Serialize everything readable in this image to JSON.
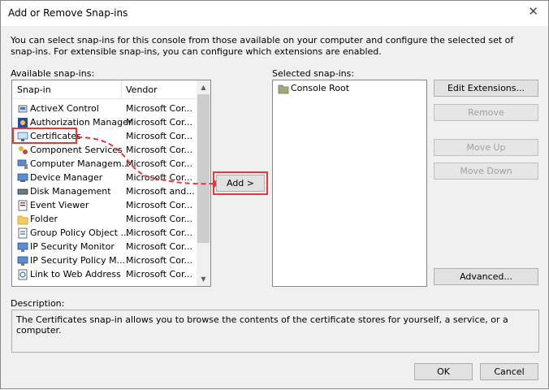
{
  "window": {
    "title": "Add or Remove Snap-ins",
    "close_glyph": "✕"
  },
  "intro": "You can select snap-ins for this console from those available on your computer and configure the selected set of snap-ins. For extensible snap-ins, you can configure which extensions are enabled.",
  "available": {
    "label": "Available snap-ins:",
    "columns": {
      "snapin": "Snap-in",
      "vendor": "Vendor"
    },
    "items": [
      {
        "name": "ActiveX Control",
        "vendor": "Microsoft Cor...",
        "icon": "activex-icon"
      },
      {
        "name": "Authorization Manager",
        "vendor": "Microsoft Cor...",
        "icon": "authorization-icon"
      },
      {
        "name": "Certificates",
        "vendor": "Microsoft Cor...",
        "icon": "certificates-icon"
      },
      {
        "name": "Component Services",
        "vendor": "Microsoft Cor...",
        "icon": "component-services-icon"
      },
      {
        "name": "Computer Managem...",
        "vendor": "Microsoft Cor...",
        "icon": "computer-management-icon"
      },
      {
        "name": "Device Manager",
        "vendor": "Microsoft Cor...",
        "icon": "device-manager-icon"
      },
      {
        "name": "Disk Management",
        "vendor": "Microsoft and...",
        "icon": "disk-management-icon"
      },
      {
        "name": "Event Viewer",
        "vendor": "Microsoft Cor...",
        "icon": "event-viewer-icon"
      },
      {
        "name": "Folder",
        "vendor": "Microsoft Cor...",
        "icon": "folder-icon"
      },
      {
        "name": "Group Policy Object ...",
        "vendor": "Microsoft Cor...",
        "icon": "group-policy-icon"
      },
      {
        "name": "IP Security Monitor",
        "vendor": "Microsoft Cor...",
        "icon": "ip-security-monitor-icon"
      },
      {
        "name": "IP Security Policy M...",
        "vendor": "Microsoft Cor...",
        "icon": "ip-security-policy-icon"
      },
      {
        "name": "Link to Web Address",
        "vendor": "Microsoft Cor...",
        "icon": "link-icon"
      }
    ]
  },
  "selected": {
    "label": "Selected snap-ins:",
    "items": [
      {
        "name": "Console Root",
        "icon": "folder-icon"
      }
    ]
  },
  "buttons": {
    "add": "Add >",
    "edit_extensions": "Edit Extensions...",
    "remove": "Remove",
    "move_up": "Move Up",
    "move_down": "Move Down",
    "advanced": "Advanced...",
    "ok": "OK",
    "cancel": "Cancel"
  },
  "description": {
    "label": "Description:",
    "text": "The Certificates snap-in allows you to browse the contents of the certificate stores for yourself, a service, or a computer."
  },
  "colors": {
    "highlight": "#e0393e"
  }
}
